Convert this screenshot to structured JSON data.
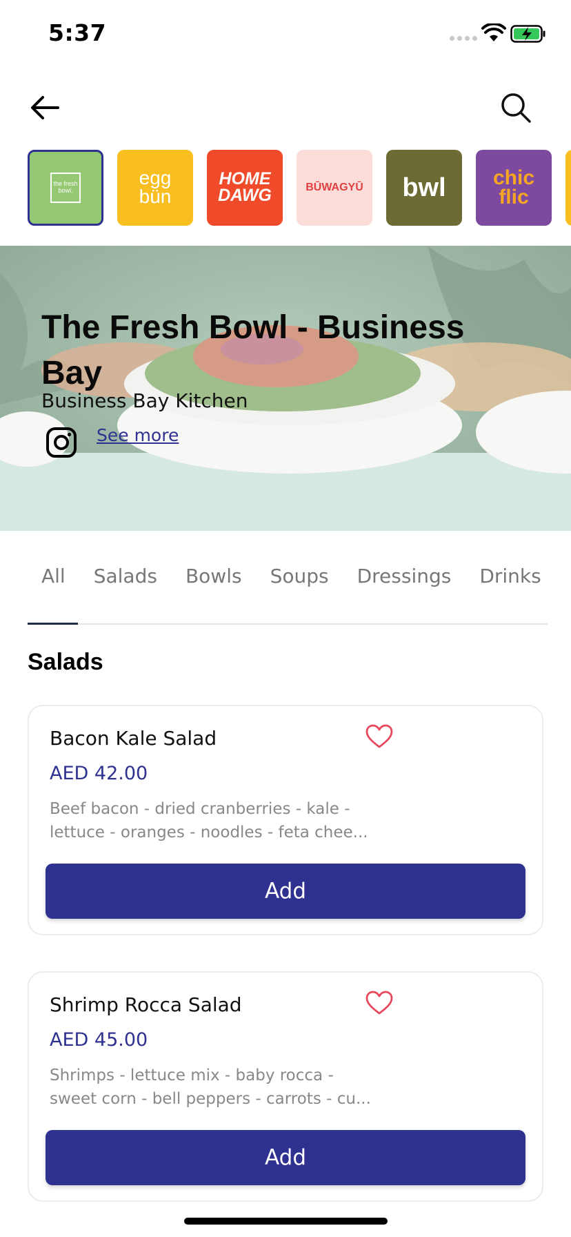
{
  "status_bar": {
    "time": "5:37"
  },
  "icons": {
    "back": "arrow-left-icon",
    "search": "search-icon",
    "instagram": "instagram-icon",
    "favorite": "heart-icon"
  },
  "brands": [
    {
      "name": "the fresh bowl.",
      "bg": "#95c872",
      "fg": "#ffffff",
      "selected": true
    },
    {
      "name": "egg bün",
      "bg": "#f9bf20",
      "fg": "#ffffff",
      "selected": false
    },
    {
      "name": "HOME DAWG",
      "bg": "#ef4b2a",
      "fg": "#ffffff",
      "selected": false
    },
    {
      "name": "BŪWAGYŪ",
      "bg": "#fbdcd9",
      "fg": "#e04041",
      "selected": false
    },
    {
      "name": "bwl",
      "bg": "#6d6b34",
      "fg": "#ffffff",
      "selected": false
    },
    {
      "name": "chic flic",
      "bg": "#7d4aa0",
      "fg": "#f5a623",
      "selected": false
    }
  ],
  "hero": {
    "title": "The Fresh Bowl - Business Bay",
    "subtitle": "Business Bay Kitchen",
    "see_more": "See more"
  },
  "tabs": [
    "All",
    "Salads",
    "Bowls",
    "Soups",
    "Dressings",
    "Drinks"
  ],
  "active_tab": "All",
  "section_title": "Salads",
  "products": [
    {
      "name": "Bacon Kale Salad",
      "price": "AED 42.00",
      "desc_line1": "Beef bacon - dried cranberries - kale -",
      "desc_line2": "lettuce - oranges - noodles - feta chee...",
      "add_label": "Add"
    },
    {
      "name": "Shrimp Rocca Salad",
      "price": "AED 45.00",
      "desc_line1": "Shrimps - lettuce mix - baby rocca -",
      "desc_line2": "sweet corn - bell peppers - carrots - cu...",
      "add_label": "Add"
    }
  ],
  "colors": {
    "accent": "#2e3190",
    "heart": "#e8485e"
  }
}
